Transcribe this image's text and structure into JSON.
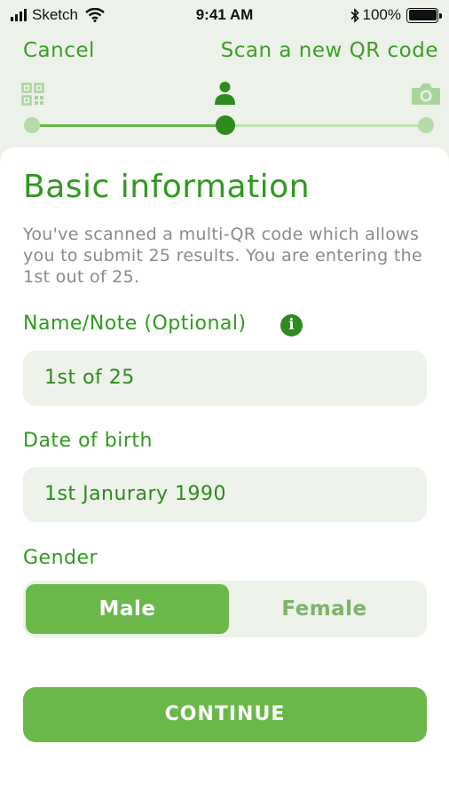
{
  "status_bar": {
    "carrier": "Sketch",
    "time": "9:41 AM",
    "battery": "100%"
  },
  "nav": {
    "cancel": "Cancel",
    "scan": "Scan a new QR code"
  },
  "steps": {
    "icons": [
      "qr-code-icon",
      "person-icon",
      "camera-icon"
    ],
    "current": 2,
    "total": 3
  },
  "form": {
    "title": "Basic information",
    "description": "You've scanned a multi-QR code which allows you to submit 25 results. You are entering the 1st out of 25.",
    "name_label": "Name/Note (Optional)",
    "name_value": "1st of 25",
    "dob_label": "Date of birth",
    "dob_value": "1st Janurary 1990",
    "gender_label": "Gender",
    "gender_options": [
      "Male",
      "Female"
    ],
    "gender_selected": "Male",
    "continue_label": "CONTINUE"
  },
  "colors": {
    "accent": "#6ab84a",
    "text_green": "#2f9a1f",
    "background": "#ecf1e9",
    "field_bg": "#edf2ea"
  }
}
